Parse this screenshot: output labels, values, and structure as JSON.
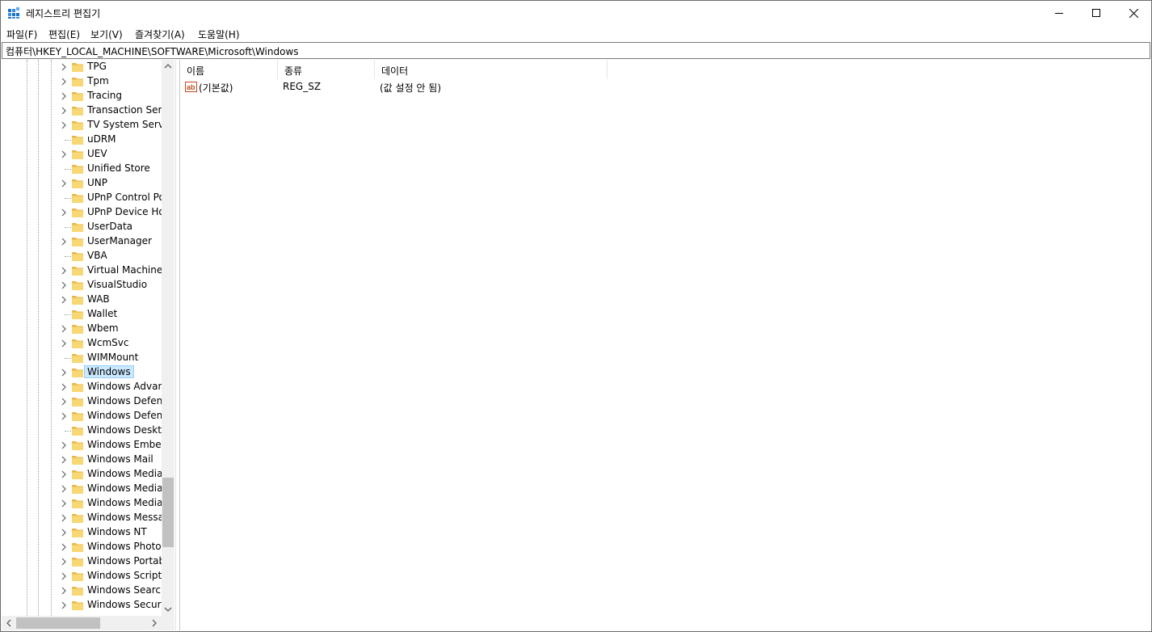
{
  "window": {
    "title": "레지스트리 편집기",
    "controls": {
      "minimize": "minimize",
      "maximize": "maximize",
      "close": "close"
    }
  },
  "menu": [
    "파일(F)",
    "편집(E)",
    "보기(V)",
    "즐겨찾기(A)",
    "도움말(H)"
  ],
  "address": "컴퓨터\\HKEY_LOCAL_MACHINE\\SOFTWARE\\Microsoft\\Windows",
  "tree": {
    "items": [
      {
        "label": "TPG",
        "expandable": true
      },
      {
        "label": "Tpm",
        "expandable": true
      },
      {
        "label": "Tracing",
        "expandable": true
      },
      {
        "label": "Transaction Server",
        "expandable": true
      },
      {
        "label": "TV System Services",
        "expandable": true
      },
      {
        "label": "uDRM",
        "expandable": false
      },
      {
        "label": "UEV",
        "expandable": true
      },
      {
        "label": "Unified Store",
        "expandable": false
      },
      {
        "label": "UNP",
        "expandable": true
      },
      {
        "label": "UPnP Control Point",
        "expandable": false
      },
      {
        "label": "UPnP Device Host",
        "expandable": true
      },
      {
        "label": "UserData",
        "expandable": false
      },
      {
        "label": "UserManager",
        "expandable": true
      },
      {
        "label": "VBA",
        "expandable": false
      },
      {
        "label": "Virtual Machine",
        "expandable": true
      },
      {
        "label": "VisualStudio",
        "expandable": true
      },
      {
        "label": "WAB",
        "expandable": true
      },
      {
        "label": "Wallet",
        "expandable": false
      },
      {
        "label": "Wbem",
        "expandable": true
      },
      {
        "label": "WcmSvc",
        "expandable": true
      },
      {
        "label": "WIMMount",
        "expandable": false
      },
      {
        "label": "Windows",
        "expandable": true,
        "selected": true
      },
      {
        "label": "Windows Advanced",
        "expandable": true
      },
      {
        "label": "Windows Defender",
        "expandable": true
      },
      {
        "label": "Windows Defender",
        "expandable": true
      },
      {
        "label": "Windows Desktop",
        "expandable": false
      },
      {
        "label": "Windows Embedded",
        "expandable": true
      },
      {
        "label": "Windows Mail",
        "expandable": true
      },
      {
        "label": "Windows Media",
        "expandable": true
      },
      {
        "label": "Windows Media",
        "expandable": true
      },
      {
        "label": "Windows Media",
        "expandable": true
      },
      {
        "label": "Windows Messaging",
        "expandable": true
      },
      {
        "label": "Windows NT",
        "expandable": true
      },
      {
        "label": "Windows Photo Viewer",
        "expandable": true
      },
      {
        "label": "Windows Portable",
        "expandable": true
      },
      {
        "label": "Windows Script Host",
        "expandable": true
      },
      {
        "label": "Windows Search",
        "expandable": true
      },
      {
        "label": "Windows Security",
        "expandable": true
      }
    ]
  },
  "list": {
    "columns": [
      "이름",
      "종류",
      "데이터"
    ],
    "rows": [
      {
        "name": "(기본값)",
        "type": "REG_SZ",
        "data": "(값 설정 안 됨)",
        "icon": "string-value-icon"
      }
    ]
  },
  "colors": {
    "selection": "#cce8ff",
    "folder": "#f8d775",
    "folder_dark": "#e8b84a",
    "accent": "#0078d7"
  }
}
